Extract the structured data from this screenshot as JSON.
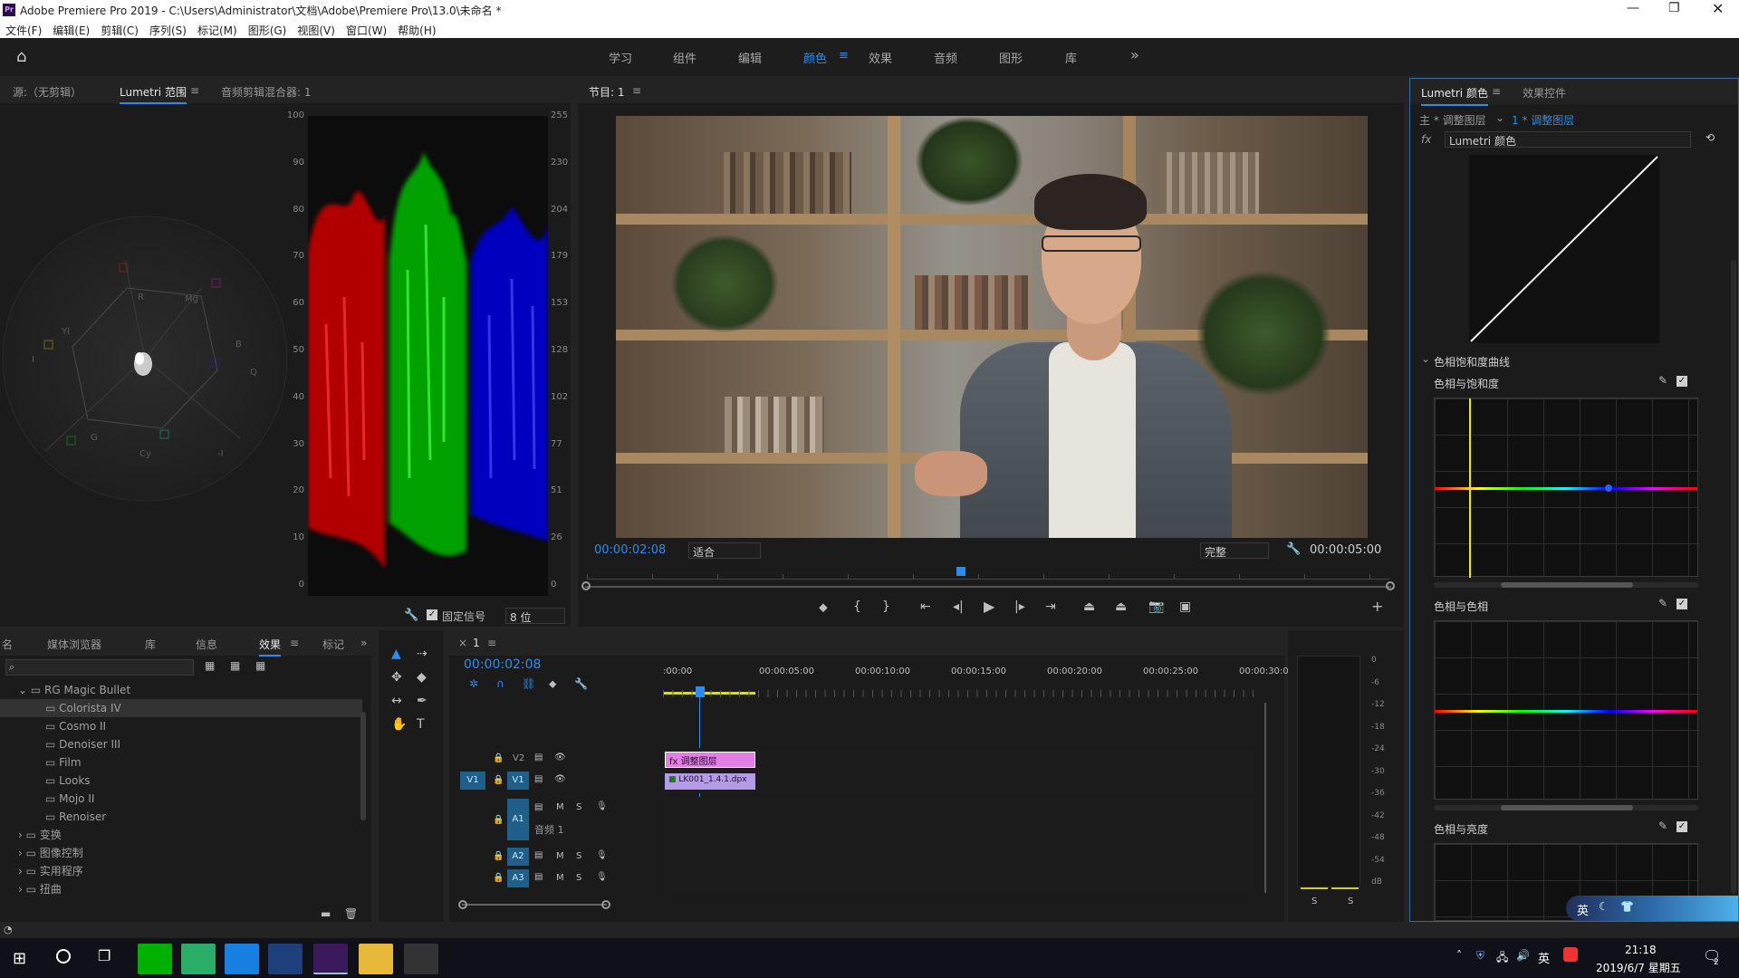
{
  "window": {
    "title": "Adobe Premiere Pro 2019 - C:\\Users\\Administrator\\文档\\Adobe\\Premiere Pro\\13.0\\未命名 *",
    "app_icon": "Pr"
  },
  "menu": [
    "文件(F)",
    "编辑(E)",
    "剪辑(C)",
    "序列(S)",
    "标记(M)",
    "图形(G)",
    "视图(V)",
    "窗口(W)",
    "帮助(H)"
  ],
  "workspaces": {
    "items": [
      "学习",
      "组件",
      "编辑",
      "颜色",
      "效果",
      "音频",
      "图形",
      "库"
    ],
    "active": "颜色",
    "more": "»"
  },
  "source_panel": {
    "tabs": [
      "源:（无剪辑）",
      "Lumetri 范围",
      "音频剪辑混合器: 1"
    ],
    "active_tab": "Lumetri 范围",
    "parade_left_ticks": [
      "100",
      "90",
      "80",
      "70",
      "60",
      "50",
      "40",
      "30",
      "20",
      "10",
      "0"
    ],
    "parade_right_ticks": [
      "255",
      "230",
      "204",
      "179",
      "153",
      "128",
      "102",
      "77",
      "51",
      "26",
      "0"
    ],
    "vectorscope_labels": [
      "R",
      "Mg",
      "B",
      "Cy",
      "G",
      "Yl",
      "I",
      "-I",
      "Q"
    ],
    "clamp_label": "固定信号",
    "bit_depth": "8 位"
  },
  "program_monitor": {
    "tab": "节目: 1",
    "current_time": "00:00:02:08",
    "fit": "适合",
    "quality": "完整",
    "duration": "00:00:05:00",
    "playhead_fraction": 0.46
  },
  "lumetri_color": {
    "tabs": [
      "Lumetri 颜色",
      "效果控件"
    ],
    "master_label": "主 * 调整图层",
    "clip_label": "1 * 调整图层",
    "effect_label": "Lumetri 颜色",
    "section": "色相饱和度曲线",
    "curves": [
      "色相与饱和度",
      "色相与色相",
      "色相与亮度"
    ]
  },
  "effects_panel": {
    "tabs": [
      "名",
      "媒体浏览器",
      "库",
      "信息",
      "效果",
      "标记"
    ],
    "active_tab": "效果",
    "root": "RG Magic Bullet",
    "items": [
      "Colorista IV",
      "Cosmo II",
      "Denoiser III",
      "Film",
      "Looks",
      "Mojo II",
      "Renoiser"
    ],
    "selected_item": "Colorista IV",
    "folders": [
      "变换",
      "图像控制",
      "实用程序",
      "扭曲"
    ]
  },
  "timeline": {
    "sequence_tab": "1",
    "current_time": "00:00:02:08",
    "ruler": [
      ":00:00",
      "00:00:05:00",
      "00:00:10:00",
      "00:00:15:00",
      "00:00:20:00",
      "00:00:25:00",
      "00:00:30:00"
    ],
    "tracks_video": [
      "V2",
      "V1"
    ],
    "tracks_audio": [
      "A1",
      "A2",
      "A3"
    ],
    "audio_track_name": "音频 1",
    "clip_adjustment": "调整图层",
    "clip_video": "LK001_1.4.1.dpx",
    "source_patch": "V1",
    "mute": "M",
    "solo": "S"
  },
  "audio_meter": {
    "ticks": [
      "0",
      "-6",
      "-12",
      "-18",
      "-24",
      "-30",
      "-36",
      "-42",
      "-48",
      "-54",
      "dB"
    ],
    "solo_labels": [
      "S",
      "S"
    ]
  },
  "taskbar": {
    "time": "21:18",
    "date": "2019/6/7 星期五",
    "ime": "英",
    "notify_count": "2"
  },
  "ime_float": {
    "label": "英"
  },
  "colors": {
    "accent": "#2d8ceb",
    "adjustment_clip": "#e27ee4",
    "video_clip": "#b49be8",
    "panel_bg": "#1b1b1b"
  }
}
